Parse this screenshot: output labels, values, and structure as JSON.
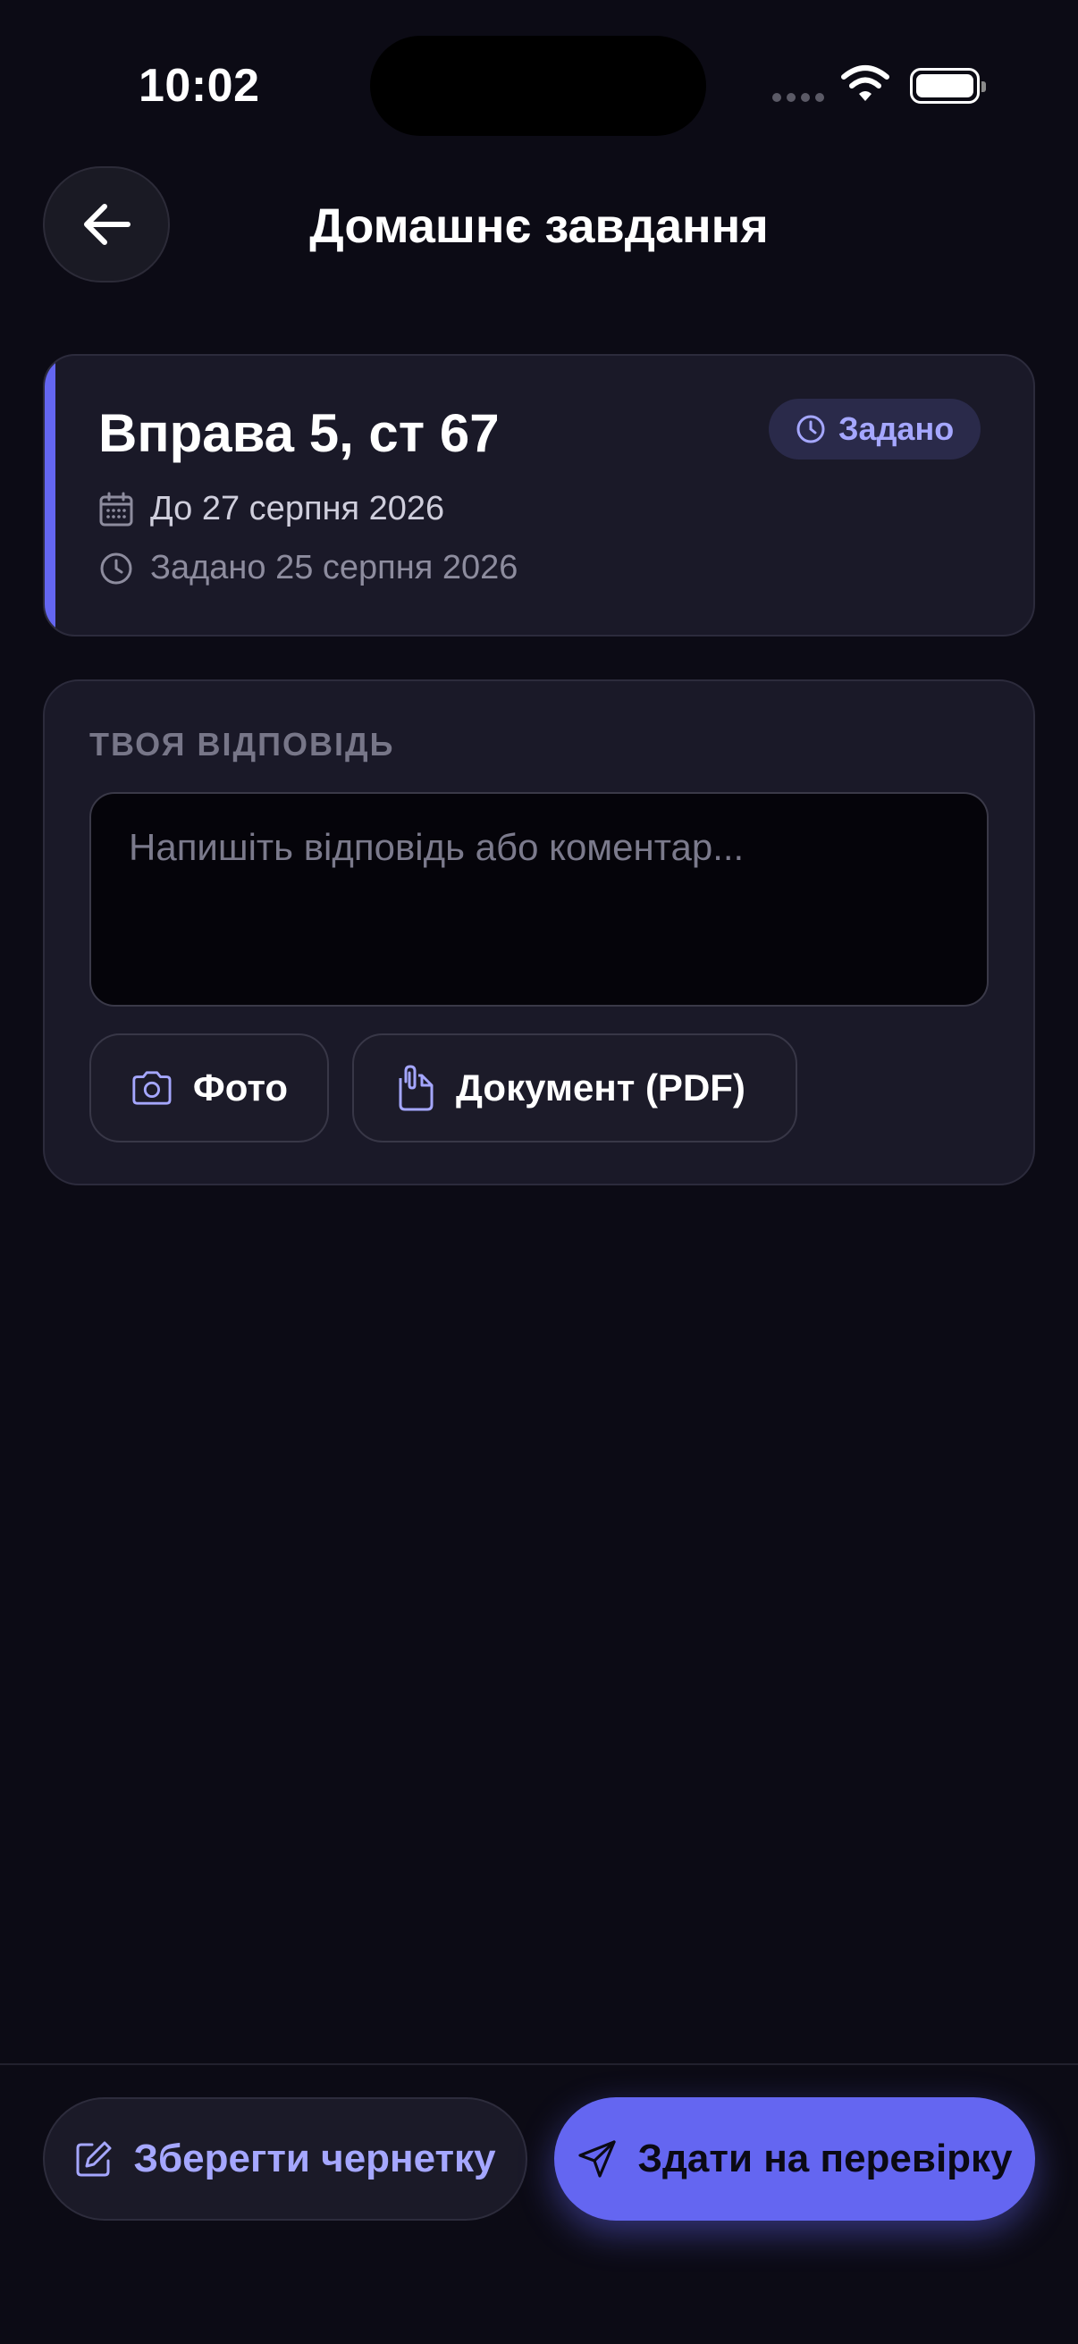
{
  "status_bar": {
    "time": "10:02"
  },
  "header": {
    "title": "Домашнє завдання",
    "back_icon": "arrow-left-icon"
  },
  "task": {
    "title": "Вправа 5, ст 67",
    "status_badge": "Задано",
    "due": "До 27 серпня 2026",
    "assigned": "Задано 25 серпня 2026"
  },
  "answer": {
    "section_label": "ТВОЯ ВІДПОВІДЬ",
    "placeholder": "Напишіть відповідь або коментар...",
    "value": "",
    "photo_button": "Фото",
    "document_button": "Документ (PDF)"
  },
  "actions": {
    "save_draft": "Зберегти чернетку",
    "submit": "Здати на перевірку"
  },
  "colors": {
    "background": "#0c0b15",
    "card": "#1a1928",
    "accent": "#6466f1",
    "accent_text": "#a5a7ff"
  }
}
